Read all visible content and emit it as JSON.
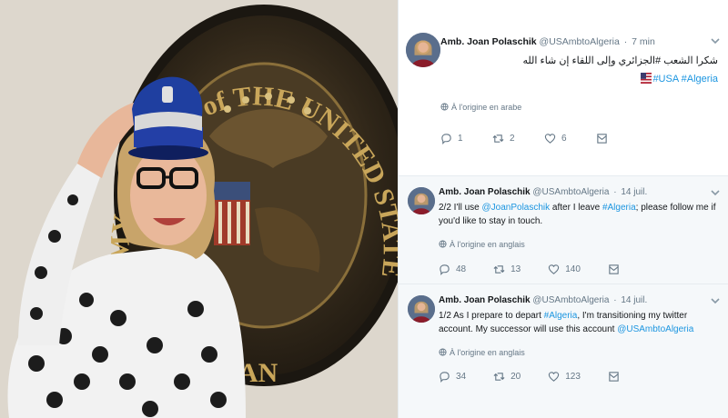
{
  "photo": {
    "seal_text_top": "ARMY AGENCY of THE UNITED STATES of AMERICA",
    "seal_text_bottom": "AN"
  },
  "tweets": [
    {
      "name": "Amb. Joan Polaschik",
      "handle": "@USAmbtoAlgeria",
      "time": "7 min",
      "caret_icon": "chevron-down-icon",
      "text_rtl": "شكرا الشعب #الجزائري وإلى اللقاء إن شاء الله",
      "hashtags": [
        "#USA",
        "#Algeria"
      ],
      "translate": "À l'origine en arabe",
      "replies": "1",
      "retweets": "2",
      "likes": "6"
    },
    {
      "name": "Amb. Joan Polaschik",
      "handle": "@USAmbtoAlgeria",
      "time": "14 juil.",
      "caret_icon": "chevron-down-icon",
      "text_parts": [
        "2/2 I'll use ",
        "@JoanPolaschik",
        " after I leave ",
        "#Algeria",
        "; please follow me if you'd like to stay in touch."
      ],
      "translate": "À l'origine en anglais",
      "replies": "48",
      "retweets": "13",
      "likes": "140"
    },
    {
      "name": "Amb. Joan Polaschik",
      "handle": "@USAmbtoAlgeria",
      "time": "14 juil.",
      "caret_icon": "chevron-down-icon",
      "text_parts": [
        "1/2 As I prepare to depart ",
        "#Algeria",
        ", I'm transitioning my twitter account.  My successor will use this account ",
        "@USAmbtoAlgeria"
      ],
      "translate": "À l'origine en anglais",
      "replies": "34",
      "retweets": "20",
      "likes": "123"
    }
  ],
  "colors": {
    "link": "#1b95e0",
    "muted": "#657786",
    "text": "#14171a",
    "highlight_bg": "#f5f8fa"
  }
}
